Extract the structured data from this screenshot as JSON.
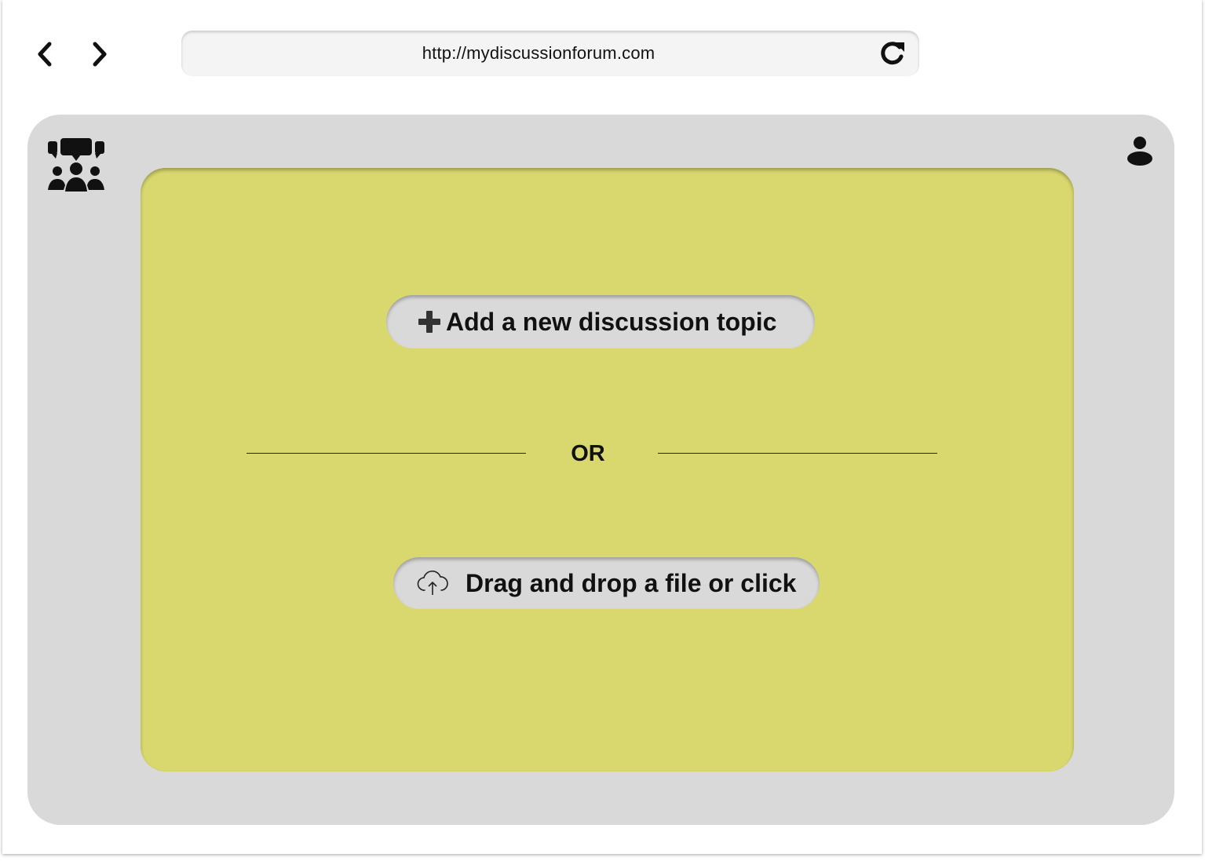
{
  "browser": {
    "url": "http://mydiscussionforum.com",
    "back_icon": "chevron-left-icon",
    "forward_icon": "chevron-right-icon",
    "reload_icon": "reload-icon"
  },
  "app": {
    "logo_icon": "discussion-group-icon",
    "profile_icon": "user-icon",
    "add_topic_label": "Add a new discussion topic",
    "divider_label": "OR",
    "upload_label": "Drag and drop a file or click",
    "colors": {
      "panel_bg": "#d9d9d9",
      "card_bg": "#d8d86e",
      "button_bg": "#d9d9d9"
    }
  }
}
